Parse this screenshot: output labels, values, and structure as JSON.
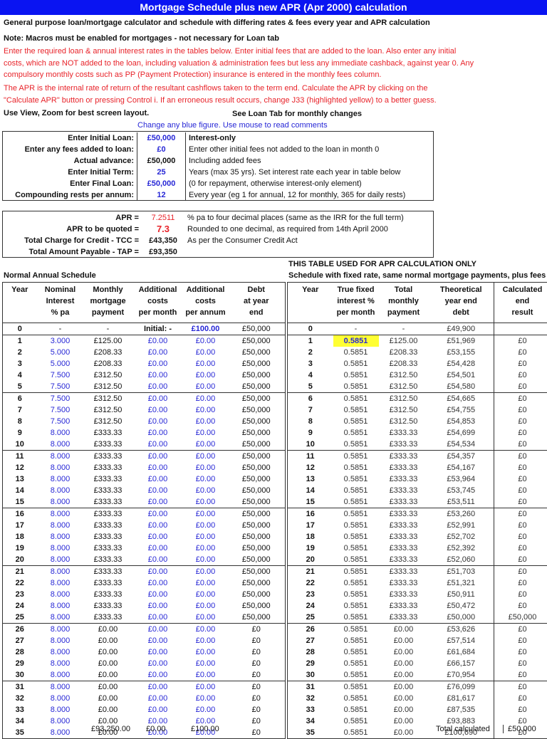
{
  "title": "Mortgage Schedule plus new APR (Apr 2000) calculation",
  "subtitle": "General purpose loan/mortgage calculator and schedule with differing rates & fees every year and APR calculation",
  "note": "Note:  Macros must be enabled for mortgages - not necessary for Loan tab",
  "instructions": [
    "Enter the required loan & annual interest rates in the tables below.  Enter initial fees that are added to the loan.  Also enter any initial",
    "costs, which are NOT added to the loan, including valuation & administration fees but less any immediate cashback, against year 0.  Any",
    "compulsory monthly costs such as PP (Payment Protection) insurance is entered in the monthly fees column."
  ],
  "apr_text": [
    "The APR is the internal rate of return of the resultant cashflows taken to the term end.  Calculate the APR by clicking on the",
    "\"Calculate APR\" button or pressing Control i. If an erroneous result occurs, change J33 (highlighted yellow) to a better guess."
  ],
  "zoom_hint": "Use View, Zoom for best screen layout.",
  "loan_tab_hint": "See Loan Tab for monthly changes",
  "blue_hint": "Change any blue figure.  Use mouse to read comments",
  "inputs": [
    {
      "label": "Enter Initial Loan:",
      "value": "£50,000",
      "desc": "Interest-only",
      "editable": true,
      "bold_desc": true
    },
    {
      "label": "Enter any fees added to loan:",
      "value": "£0",
      "desc": "Enter other initial fees not added to the loan in month 0",
      "editable": true
    },
    {
      "label": "Actual advance:",
      "value": "£50,000",
      "desc": "Including added fees",
      "editable": false
    },
    {
      "label": "Enter Initial Term:",
      "value": "25",
      "desc": "Years (max 35 yrs).  Set interest rate each year in table below",
      "editable": true
    },
    {
      "label": "Enter Final Loan:",
      "value": "£50,000",
      "desc": "(0 for repayment, otherwise interest-only element)",
      "editable": true
    },
    {
      "label": "Compounding rests per annum:",
      "value": "12",
      "desc": "Every year (eg 1 for annual, 12 for monthly, 365 for daily rests)",
      "editable": true
    }
  ],
  "apr": [
    {
      "label": "APR =",
      "value": "7.2511",
      "desc": "% pa to four decimal places (same as the IRR for the full term)"
    },
    {
      "label": "APR to be quoted =",
      "value": "7.3",
      "desc": "Rounded to one decimal, as required from 14th April 2000"
    },
    {
      "label": "Total Charge for Credit - TCC =",
      "value": "£43,350",
      "desc": "As per the Consumer Credit Act"
    },
    {
      "label": "Total Amount Payable - TAP =",
      "value": "£93,350",
      "desc": ""
    }
  ],
  "colors": {
    "title_bar": "#0a14f2",
    "editable": "#2727d6",
    "instruction": "#e8232a",
    "highlight": "#ffff33"
  },
  "normal": {
    "title": "Normal Annual Schedule",
    "headers": [
      [
        "Year",
        "",
        ""
      ],
      [
        "Nominal",
        "Interest",
        "% pa"
      ],
      [
        "Monthly",
        "mortgage",
        "payment"
      ],
      [
        "Additional",
        "costs",
        "per month"
      ],
      [
        "Additional",
        "costs",
        "per annum"
      ],
      [
        "Debt",
        "at year",
        "end"
      ]
    ],
    "row0": [
      "0",
      "-",
      "-",
      "Initial: -",
      "£100.00",
      "£50,000"
    ],
    "rates": [
      "3.000",
      "5.000",
      "5.000",
      "7.500",
      "7.500",
      "7.500",
      "7.500",
      "7.500",
      "8.000",
      "8.000",
      "8.000",
      "8.000",
      "8.000",
      "8.000",
      "8.000",
      "8.000",
      "8.000",
      "8.000",
      "8.000",
      "8.000",
      "8.000",
      "8.000",
      "8.000",
      "8.000",
      "8.000",
      "8.000",
      "8.000",
      "8.000",
      "8.000",
      "8.000",
      "8.000",
      "8.000",
      "8.000",
      "8.000",
      "8.000"
    ],
    "payments": [
      "£125.00",
      "£208.33",
      "£208.33",
      "£312.50",
      "£312.50",
      "£312.50",
      "£312.50",
      "£312.50",
      "£333.33",
      "£333.33",
      "£333.33",
      "£333.33",
      "£333.33",
      "£333.33",
      "£333.33",
      "£333.33",
      "£333.33",
      "£333.33",
      "£333.33",
      "£333.33",
      "£333.33",
      "£333.33",
      "£333.33",
      "£333.33",
      "£333.33",
      "£0.00",
      "£0.00",
      "£0.00",
      "£0.00",
      "£0.00",
      "£0.00",
      "£0.00",
      "£0.00",
      "£0.00",
      "£0.00"
    ],
    "cost_month": "£0.00",
    "cost_annum": "£0.00",
    "debts": [
      "£50,000",
      "£50,000",
      "£50,000",
      "£50,000",
      "£50,000",
      "£50,000",
      "£50,000",
      "£50,000",
      "£50,000",
      "£50,000",
      "£50,000",
      "£50,000",
      "£50,000",
      "£50,000",
      "£50,000",
      "£50,000",
      "£50,000",
      "£50,000",
      "£50,000",
      "£50,000",
      "£50,000",
      "£50,000",
      "£50,000",
      "£50,000",
      "£50,000",
      "£0",
      "£0",
      "£0",
      "£0",
      "£0",
      "£0",
      "£0",
      "£0",
      "£0",
      "£0"
    ],
    "totals": [
      "£93,250.00",
      "£0.00",
      "£100.00"
    ]
  },
  "apr_table": {
    "note": "THIS TABLE USED FOR APR CALCULATION ONLY",
    "title": "Schedule with fixed rate, same normal mortgage payments, plus fees",
    "headers": [
      [
        "Year",
        "",
        ""
      ],
      [
        "True fixed",
        "interest %",
        "per month"
      ],
      [
        "Total",
        "monthly",
        "payment"
      ],
      [
        "Theoretical",
        "year end",
        "debt"
      ],
      [
        "Calculated",
        "end",
        "result"
      ]
    ],
    "row0": [
      "0",
      "-",
      "-",
      "£49,900",
      ""
    ],
    "rate": "0.5851",
    "debts": [
      "£51,969",
      "£53,155",
      "£54,428",
      "£54,501",
      "£54,580",
      "£54,665",
      "£54,755",
      "£54,853",
      "£54,699",
      "£54,534",
      "£54,357",
      "£54,167",
      "£53,964",
      "£53,745",
      "£53,511",
      "£53,260",
      "£52,991",
      "£52,702",
      "£52,392",
      "£52,060",
      "£51,703",
      "£51,321",
      "£50,911",
      "£50,472",
      "£50,000",
      "£53,626",
      "£57,514",
      "£61,684",
      "£66,157",
      "£70,954",
      "£76,099",
      "£81,617",
      "£87,535",
      "£93,883",
      "£100,690"
    ],
    "results": [
      "£0",
      "£0",
      "£0",
      "£0",
      "£0",
      "£0",
      "£0",
      "£0",
      "£0",
      "£0",
      "£0",
      "£0",
      "£0",
      "£0",
      "£0",
      "£0",
      "£0",
      "£0",
      "£0",
      "£0",
      "£0",
      "£0",
      "£0",
      "£0",
      "£50,000",
      "£0",
      "£0",
      "£0",
      "£0",
      "£0",
      "£0",
      "£0",
      "£0",
      "£0",
      "£0"
    ],
    "total_label": "Total calculated",
    "total_value": "£50,000"
  }
}
